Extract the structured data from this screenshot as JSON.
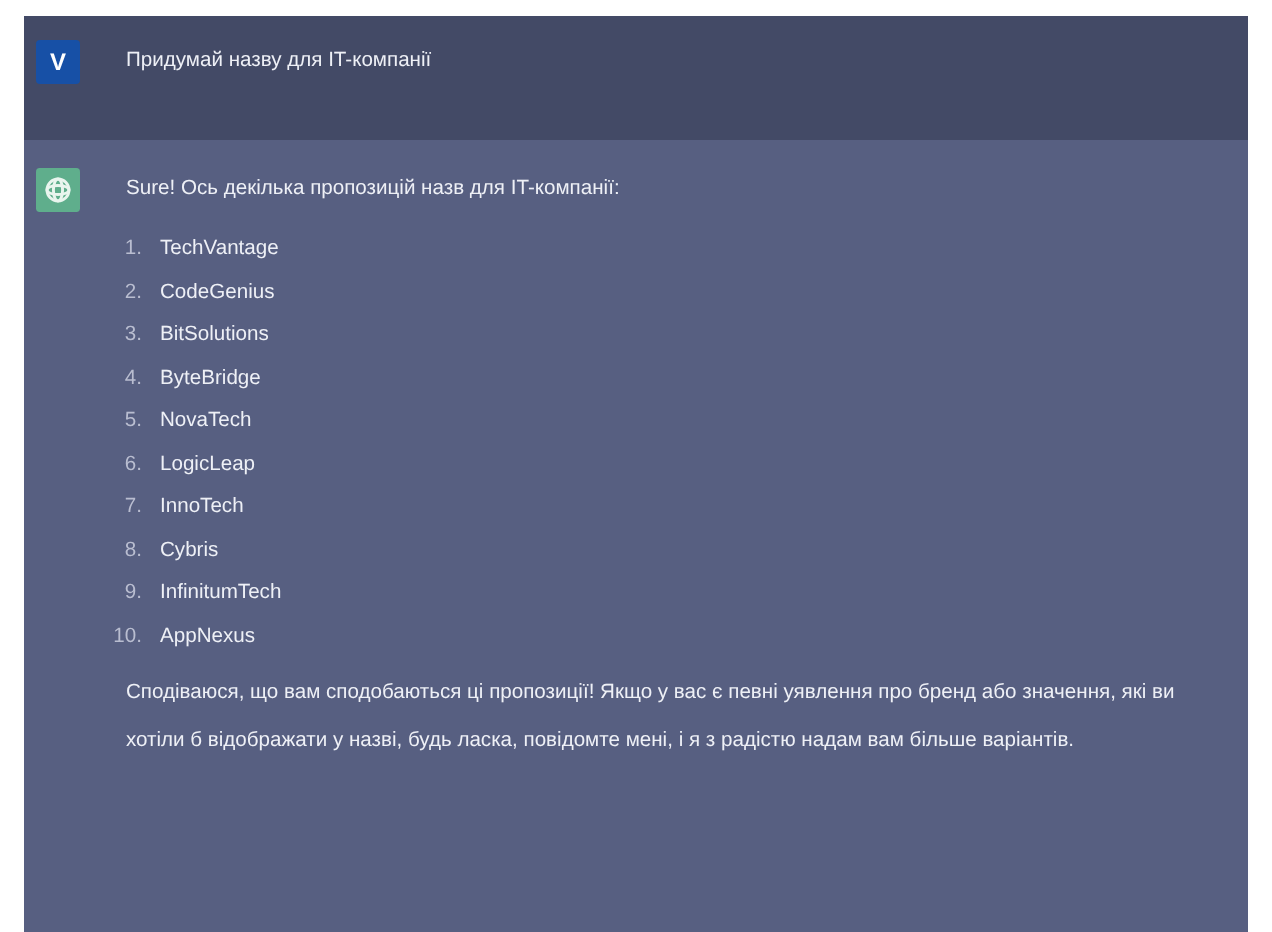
{
  "messages": [
    {
      "kind": "user",
      "avatar": "V",
      "text": "Придумай назву для IT-компанії"
    },
    {
      "kind": "assistant",
      "intro": "Sure! Ось декілька пропозицій назв для IT-компанії:",
      "items": [
        {
          "number": "1.",
          "name": "TechVantage"
        },
        {
          "number": "2.",
          "name": "CodeGenius"
        },
        {
          "number": "3.",
          "name": "BitSolutions"
        },
        {
          "number": "4.",
          "name": "ByteBridge"
        },
        {
          "number": "5.",
          "name": "NovaTech"
        },
        {
          "number": "6.",
          "name": "LogicLeap"
        },
        {
          "number": "7.",
          "name": "InnoTech"
        },
        {
          "number": "8.",
          "name": "Cybris"
        },
        {
          "number": "9.",
          "name": "InfinitumTech"
        },
        {
          "number": "10.",
          "name": "AppNexus"
        }
      ],
      "outro": "Сподіваюся, що вам сподобаються ці пропозиції! Якщо у вас є певні уявлення про бренд або значення, які ви хотіли б відображати у назві, будь ласка, повідомте мені, і я з радістю надам вам більше варіантів."
    }
  ]
}
